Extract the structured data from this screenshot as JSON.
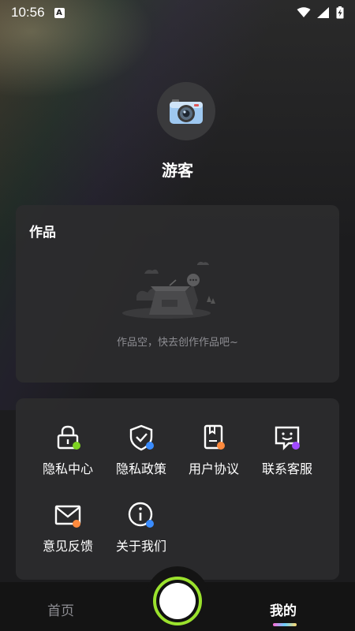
{
  "status_bar": {
    "time": "10:56",
    "notif_badge": "A"
  },
  "profile": {
    "avatar_icon": "camera-icon",
    "username": "游客"
  },
  "works": {
    "title": "作品",
    "empty_text": "作品空，快去创作作品吧~"
  },
  "menu": {
    "items": [
      {
        "label": "隐私中心",
        "icon": "lock-icon"
      },
      {
        "label": "隐私政策",
        "icon": "shield-check-icon"
      },
      {
        "label": "用户协议",
        "icon": "book-icon"
      },
      {
        "label": "联系客服",
        "icon": "chat-smile-icon"
      },
      {
        "label": "意见反馈",
        "icon": "mail-icon"
      },
      {
        "label": "关于我们",
        "icon": "info-icon"
      }
    ]
  },
  "tabbar": {
    "home_label": "首页",
    "mine_label": "我的"
  },
  "colors": {
    "fab_ring": "#9be22d",
    "accent_green": "#7ed321",
    "accent_blue": "#3a8cff",
    "accent_orange": "#ff8a3d",
    "accent_purple": "#a24bff"
  }
}
